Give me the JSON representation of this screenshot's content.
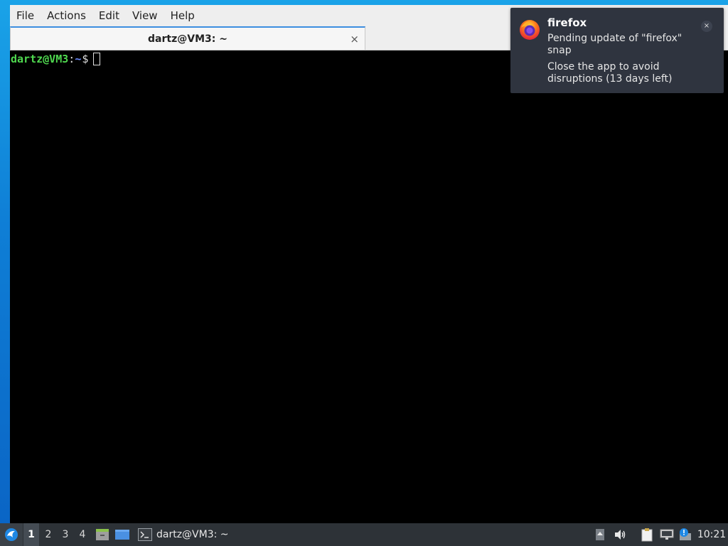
{
  "menubar": {
    "items": [
      "File",
      "Actions",
      "Edit",
      "View",
      "Help"
    ]
  },
  "tab": {
    "title": "dartz@VM3: ~",
    "close_glyph": "×"
  },
  "terminal": {
    "user_host": "dartz@VM3",
    "colon": ":",
    "path": "~",
    "dollar": "$"
  },
  "notification": {
    "app_icon": "firefox-icon",
    "title": "firefox",
    "line1": "Pending update of \"firefox\" snap",
    "line2": "Close the app to avoid disruptions (13 days left)",
    "close_glyph": "×"
  },
  "taskbar": {
    "start_icon": "lubuntu-menu-icon",
    "workspaces": [
      "1",
      "2",
      "3",
      "4"
    ],
    "active_workspace": "1",
    "launchers": [
      "file-manager-icon",
      "show-desktop-icon"
    ],
    "task_label": "dartz@VM3: ~",
    "tray_icons": [
      "tray-up-arrow-icon",
      "volume-icon",
      "clipboard-icon",
      "network-icon",
      "update-notifier-icon"
    ],
    "clock": "10:21"
  },
  "colors": {
    "desktop": "#0f7fd6",
    "terminal_bg": "#000000",
    "prompt_user": "#4fd84f",
    "prompt_path": "#6b8cff",
    "notification_bg": "#2f343f",
    "taskbar_bg": "#2d3237",
    "tab_accent": "#3d8ee0"
  }
}
